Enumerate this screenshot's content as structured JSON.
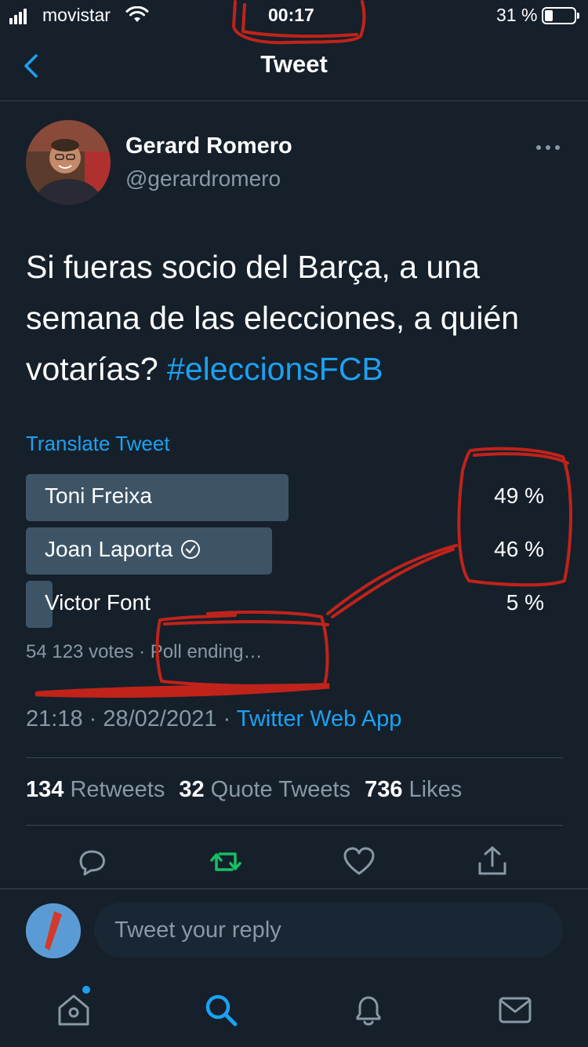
{
  "status_bar": {
    "carrier": "movistar",
    "time": "00:17",
    "battery": "31 %"
  },
  "nav": {
    "title": "Tweet"
  },
  "author": {
    "name": "Gerard Romero",
    "handle": "@gerardromero"
  },
  "tweet": {
    "text": "Si fueras socio del Barça, a una semana de las elecciones, a quién votarías? ",
    "hashtag": "#eleccionsFCB",
    "translate": "Translate Tweet",
    "date": "21:18 · 28/02/2021 · ",
    "source": "Twitter Web App"
  },
  "poll": {
    "options": [
      {
        "label": "Toni Freixa",
        "percent": "49 %",
        "value": 49,
        "winner": false
      },
      {
        "label": "Joan Laporta",
        "percent": "46 %",
        "value": 46,
        "winner": true
      },
      {
        "label": "Victor Font",
        "percent": "5 %",
        "value": 5,
        "winner": false
      }
    ],
    "votes": "54 123 votes",
    "status": " · Poll ending…"
  },
  "stats": {
    "retweets_count": "134",
    "retweets_label": "Retweets",
    "quotes_count": "32",
    "quotes_label": "Quote Tweets",
    "likes_count": "736",
    "likes_label": "Likes"
  },
  "reply": {
    "placeholder": "Tweet your reply"
  },
  "icons": {
    "back": "chevron-left-icon",
    "more": "more-horizontal-icon",
    "reply": "reply-icon",
    "retweet": "retweet-icon",
    "like": "heart-icon",
    "share": "share-icon",
    "home": "home-icon",
    "search": "search-icon",
    "notifications": "bell-icon",
    "messages": "mail-icon"
  },
  "colors": {
    "background": "#15202b",
    "accent": "#1da1f2",
    "retweet_active": "#17bf63",
    "muted": "#8899a6",
    "poll_bar": "#3d5466",
    "annotation": "#c0231a"
  }
}
